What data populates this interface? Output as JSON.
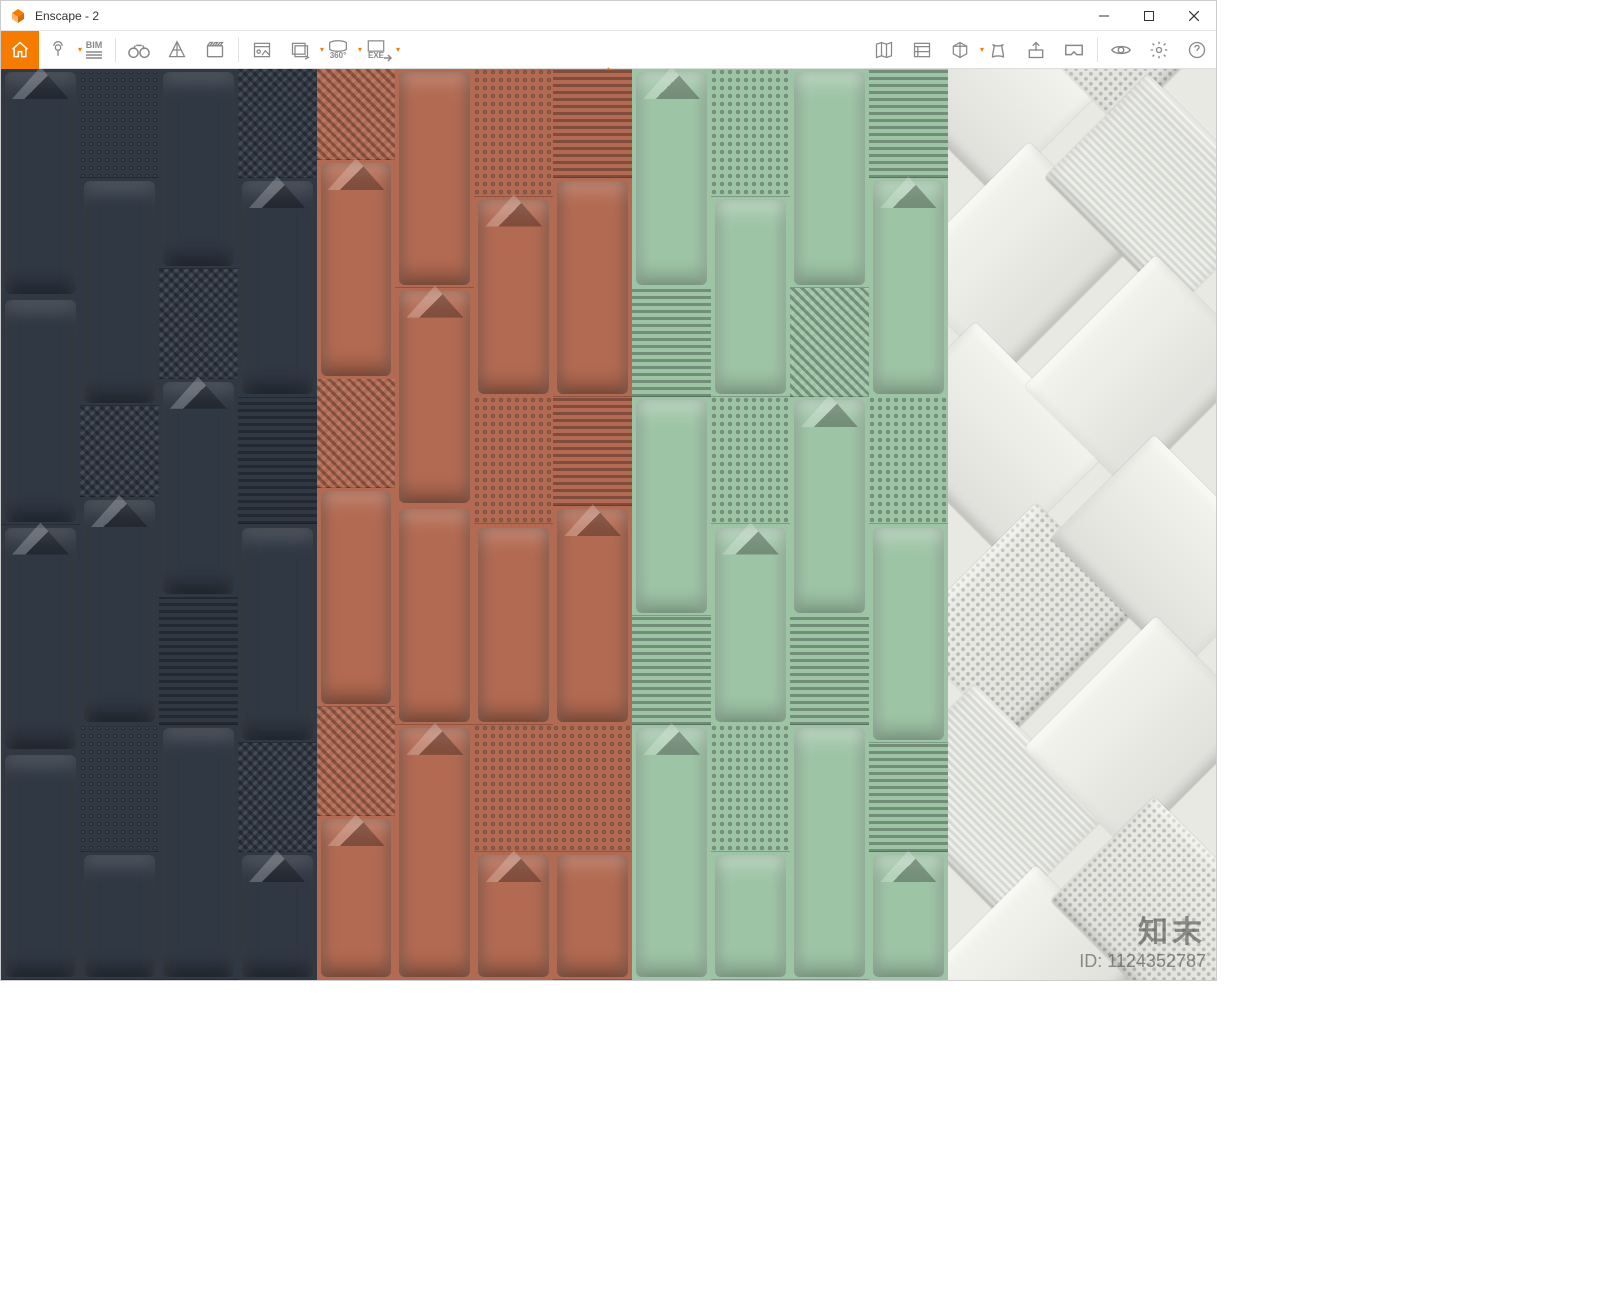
{
  "app": {
    "title": "Enscape - 2"
  },
  "icons": {
    "app": "enscape",
    "home": "home-icon",
    "pin": "map-pin-icon",
    "bim": "bim-icon",
    "binoculars": "binoculars-icon",
    "light": "light-analysis-icon",
    "clapper": "clapper-icon",
    "batch1": "batch-render-icon",
    "batch2": "favorite-views-icon",
    "pano": "pano-360-icon",
    "exe": "exe-export-icon",
    "map": "minimap-icon",
    "asset": "asset-library-icon",
    "cube": "material-cube-icon",
    "site": "site-context-icon",
    "upload": "upload-icon",
    "vr": "vr-headset-icon",
    "eye": "visual-settings-icon",
    "gear": "gear-icon",
    "help": "help-icon",
    "min": "minimize-icon",
    "max": "maximize-icon",
    "close": "close-icon",
    "caret": "chevron-down-icon"
  },
  "labels": {
    "bim_text": "BIM",
    "pano_text": "360°",
    "exe_text": "EXE"
  },
  "watermark": {
    "brand": "知末",
    "id_label": "ID: 1124352787"
  },
  "colors": {
    "accent": "#f57c00",
    "panel_navy": "#303844",
    "panel_terracotta": "#b36a52",
    "panel_sage": "#9ec4a6",
    "panel_white": "#e9e9e4"
  },
  "viewport": {
    "description": "3D tile material samples in four vertical color groups",
    "panels": [
      "navy",
      "terracotta",
      "sage",
      "white-herringbone"
    ],
    "tile_textures": [
      "smooth-pill",
      "chevron",
      "horizontal-lines",
      "pyramid-studs"
    ]
  }
}
